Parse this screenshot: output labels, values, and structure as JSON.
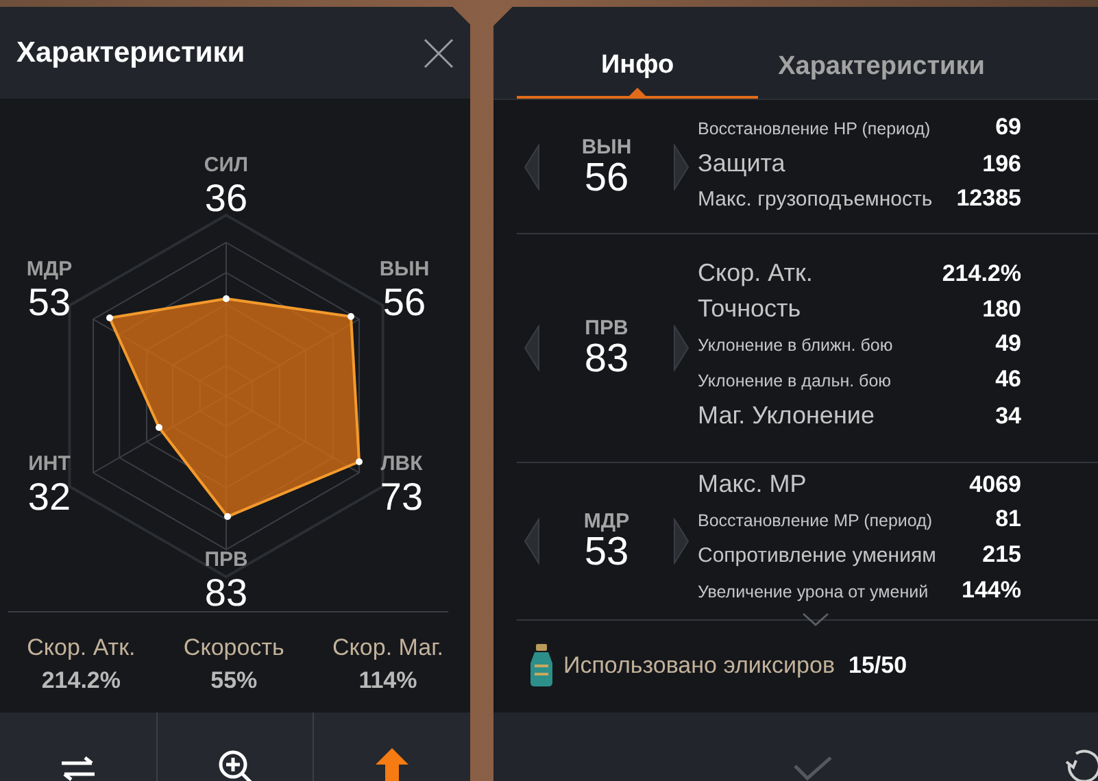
{
  "left_panel": {
    "title": "Характеристики",
    "stats": [
      {
        "label": "СИЛ",
        "value": "36"
      },
      {
        "label": "ВЫН",
        "value": "56"
      },
      {
        "label": "ЛВК",
        "value": "73"
      },
      {
        "label": "ПРВ",
        "value": "83"
      },
      {
        "label": "ИНТ",
        "value": "32"
      },
      {
        "label": "МДР",
        "value": "53"
      }
    ],
    "speeds": [
      {
        "label": "Скор. Атк.",
        "value": "214.2%"
      },
      {
        "label": "Скорость",
        "value": "55%"
      },
      {
        "label": "Скор. Маг.",
        "value": "114%"
      }
    ]
  },
  "right_panel": {
    "tabs": [
      {
        "label": "Инфо",
        "selected": true
      },
      {
        "label": "Характеристики",
        "selected": false
      }
    ],
    "sections": [
      {
        "stat_label": "ВЫН",
        "stat_value": "56",
        "rows": [
          {
            "kind": "small",
            "label": "Восстановление HP (период)",
            "value": "69"
          },
          {
            "kind": "large",
            "label": "Защита",
            "value": "196"
          },
          {
            "kind": "medium",
            "label": "Макс. грузоподъемность",
            "value": "12385"
          }
        ]
      },
      {
        "stat_label": "ПРВ",
        "stat_value": "83",
        "rows": [
          {
            "kind": "large",
            "label": "Скор. Атк.",
            "value": "214.2%"
          },
          {
            "kind": "large",
            "label": "Точность",
            "value": "180"
          },
          {
            "kind": "small",
            "label": "Уклонение в ближн. бою",
            "value": "49"
          },
          {
            "kind": "small",
            "label": "Уклонение в дальн. бою",
            "value": "46"
          },
          {
            "kind": "large",
            "label": "Маг. Уклонение",
            "value": "34"
          }
        ]
      },
      {
        "stat_label": "МДР",
        "stat_value": "53",
        "rows": [
          {
            "kind": "large",
            "label": "Макс. MP",
            "value": "4069"
          },
          {
            "kind": "small",
            "label": "Восстановление MP (период)",
            "value": "81"
          },
          {
            "kind": "medium",
            "label": "Сопротивление умениям",
            "value": "215"
          },
          {
            "kind": "small",
            "label": "Увеличение урона от умений",
            "value": "144%"
          }
        ]
      }
    ],
    "elixirs": {
      "label": "Использовано эликсиров",
      "value": "15/50"
    }
  }
}
